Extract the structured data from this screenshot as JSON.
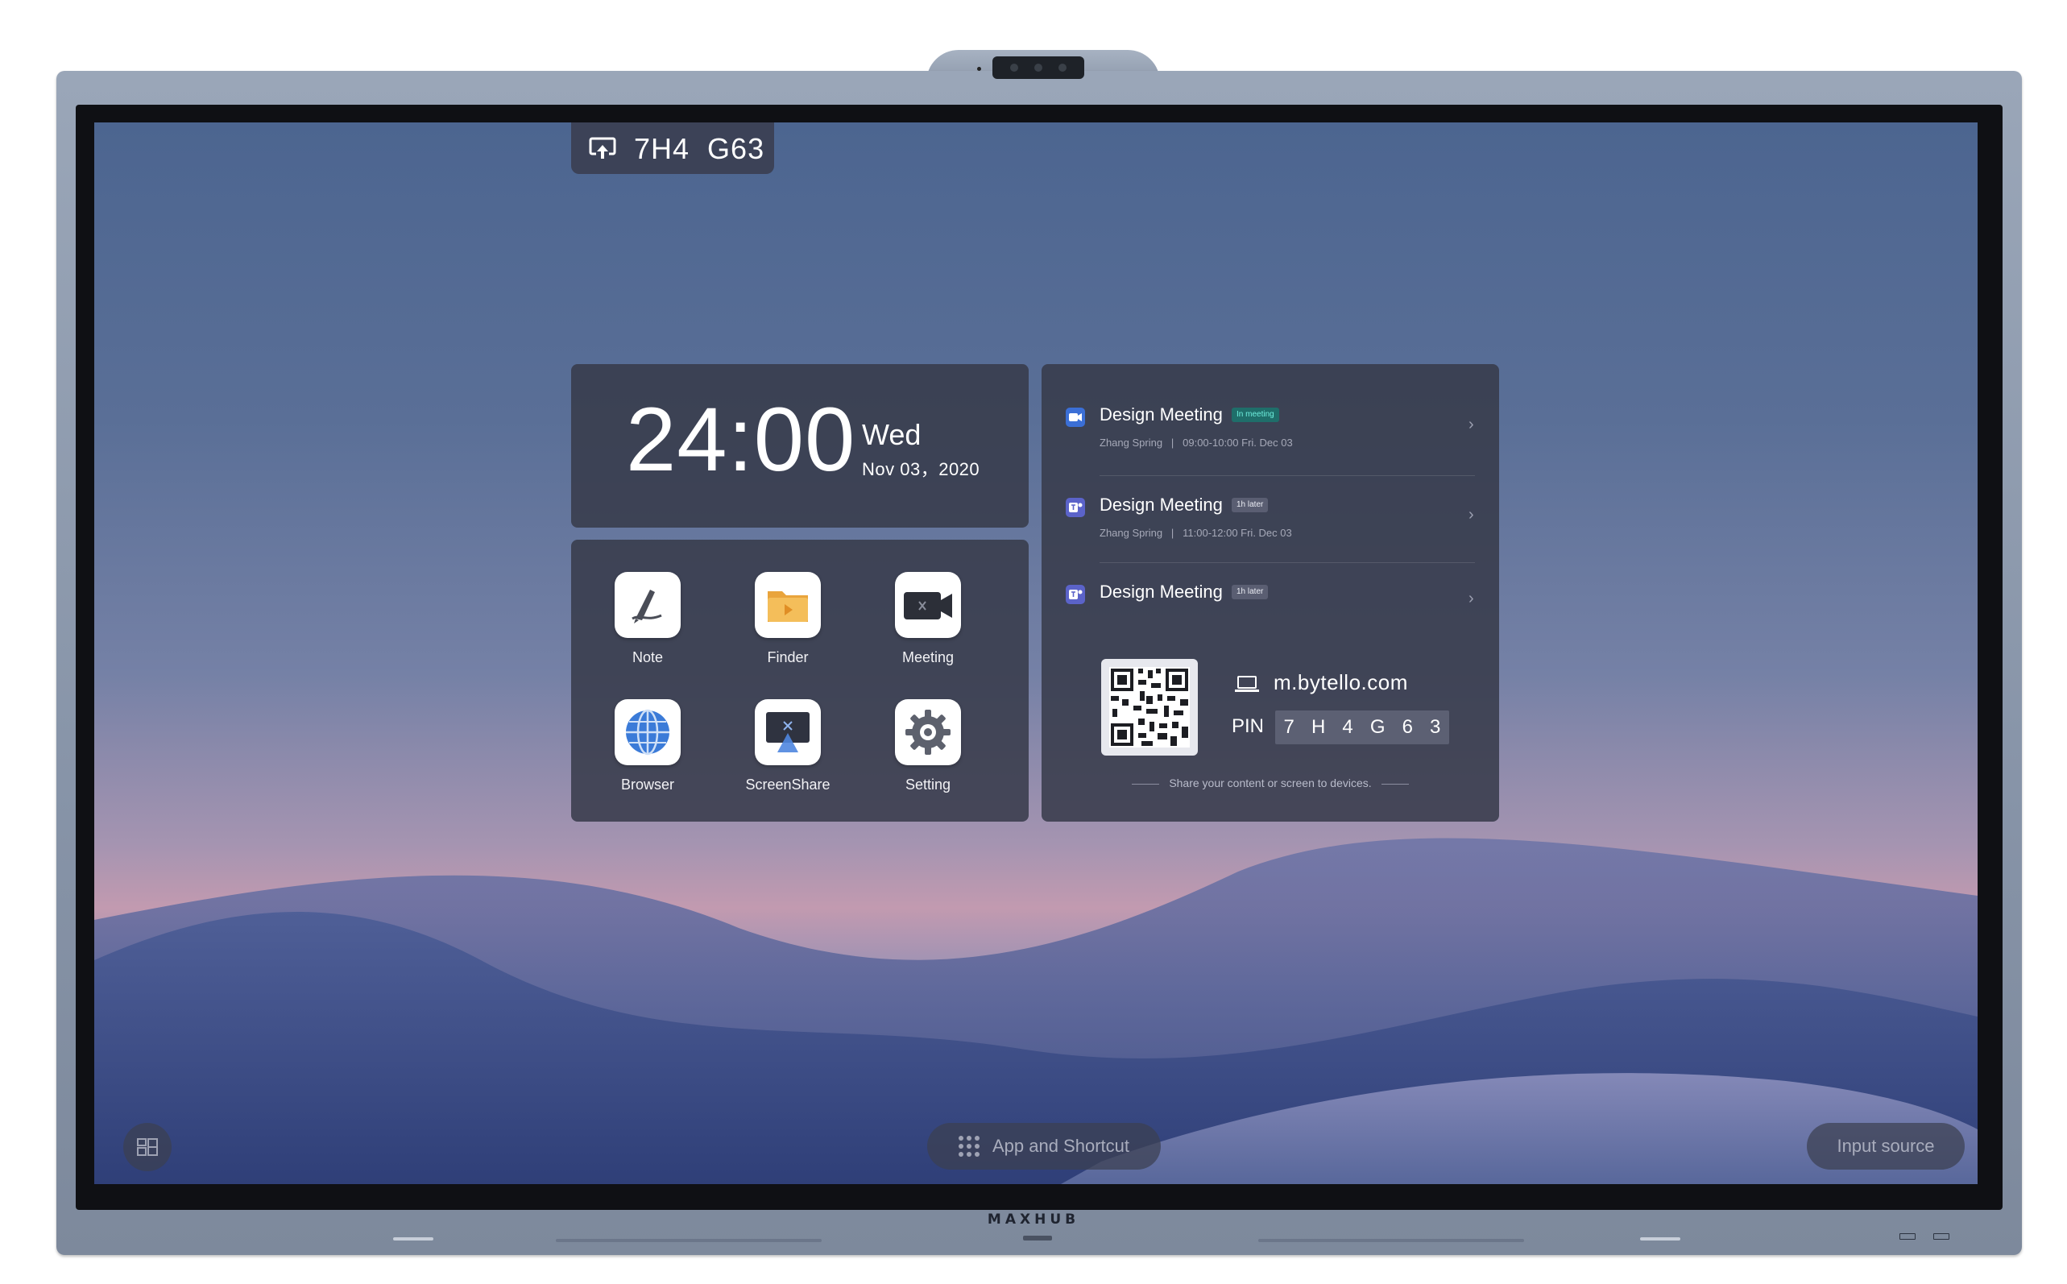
{
  "device": {
    "brand": "MAXHUB"
  },
  "cast": {
    "code": "7H4  G63",
    "icon": "screen-cast-icon"
  },
  "clock": {
    "time": "24:00",
    "day": "Wed",
    "date": "Nov 03，2020"
  },
  "apps": [
    {
      "label": "Note",
      "icon": "note-pen-icon"
    },
    {
      "label": "Finder",
      "icon": "folder-icon"
    },
    {
      "label": "Meeting",
      "icon": "video-camera-icon"
    },
    {
      "label": "Browser",
      "icon": "globe-icon"
    },
    {
      "label": "ScreenShare",
      "icon": "screen-share-icon"
    },
    {
      "label": "Setting",
      "icon": "gear-icon"
    }
  ],
  "schedule": {
    "meetings": [
      {
        "title": "Design Meeting",
        "badge": "In meeting",
        "organizer": "Zhang Spring",
        "time": "09:00-10:00 Fri. Dec 03",
        "icon": "zoom-video-icon"
      },
      {
        "title": "Design Meeting",
        "badge": "1h later",
        "organizer": "Zhang Spring",
        "time": "11:00-12:00 Fri. Dec 03",
        "icon": "teams-icon"
      },
      {
        "title": "Design Meeting",
        "badge": "1h later",
        "organizer": "",
        "time": "",
        "icon": "teams-icon"
      }
    ],
    "share": {
      "url": "m.bytello.com",
      "pin_label": "PIN",
      "pin_digits": [
        "7",
        "H",
        "4",
        "G",
        "6",
        "3"
      ],
      "hint": "Share your content or screen to devices."
    }
  },
  "taskbar": {
    "app_shortcut": "App and Shortcut",
    "input_source": "Input source"
  },
  "colors": {
    "card_bg": "#373a49",
    "badge_in_meeting": "#3ec9b9",
    "badge_later": "#5a5e72",
    "accent_blue": "#3b6fd6"
  }
}
